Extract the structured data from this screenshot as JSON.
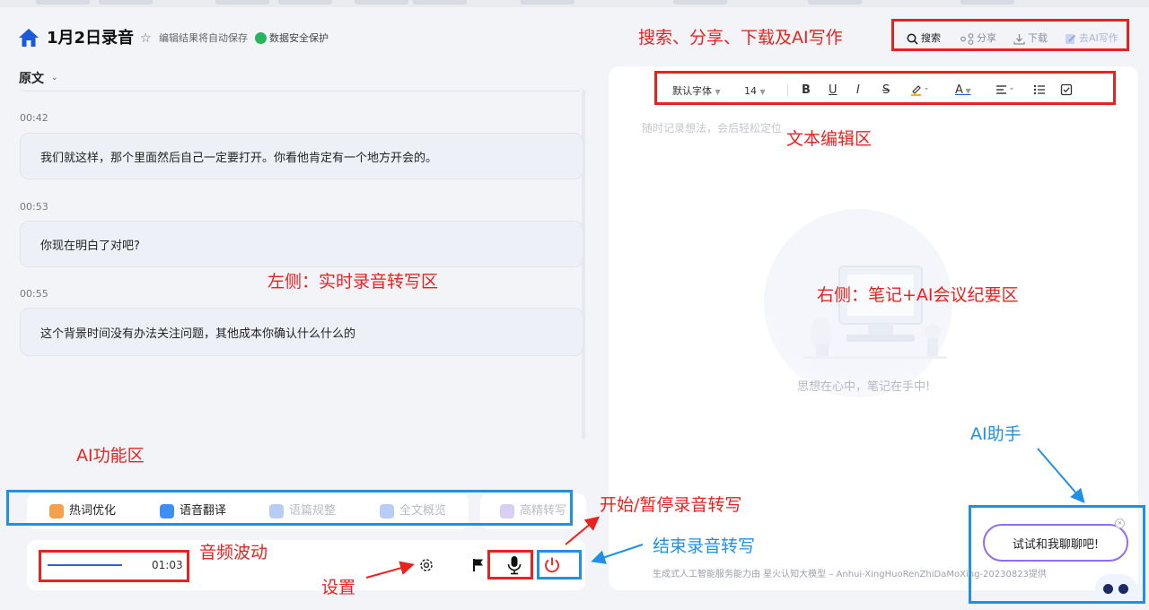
{
  "header": {
    "title": "1月2日录音",
    "autosave_note": "编辑结果将自动保存",
    "security_note": "数据安全保护",
    "actions": {
      "search": "搜索",
      "share": "分享",
      "download": "下载",
      "ai_write": "去AI写作"
    }
  },
  "transcript": {
    "section_label": "原文",
    "entries": [
      {
        "time": "00:42",
        "text": "我们就这样，那个里面然后自己一定要打开。你看他肯定有一个地方开会的。"
      },
      {
        "time": "00:53",
        "text": "你现在明白了对吧?"
      },
      {
        "time": "00:55",
        "text": "这个背景时间没有办法关注问题，其他成本你确认什么什么的"
      }
    ]
  },
  "ai_functions": [
    {
      "label": "热词优化",
      "color": "#f5a04a"
    },
    {
      "label": "语音翻译",
      "color": "#3d8ef5"
    },
    {
      "label": "语篇规整",
      "color": "#b8cdf5"
    },
    {
      "label": "全文概览",
      "color": "#b8cdf5"
    },
    {
      "label": "高精转写",
      "color": "#d9cff5"
    }
  ],
  "recorder": {
    "elapsed": "01:03"
  },
  "editor": {
    "font_family": "默认字体",
    "font_size": "14",
    "placeholder": "随时记录想法，会后轻松定位",
    "empty_state": "思想在心中，笔记在手中!",
    "footer": "生成式人工智能服务能力由 星火认知大模型 – Anhui-XingHuoRenZhiDaMoXing-20230823提供"
  },
  "assistant": {
    "greeting": "试试和我聊聊吧!"
  },
  "annotations": {
    "header_actions": "搜索、分享、下载及AI写作",
    "text_editor": "文本编辑区",
    "left_area": "左侧：实时录音转写区",
    "right_area": "右侧：笔记+AI会议纪要区",
    "ai_area": "AI功能区",
    "start_pause": "开始/暂停录音转写",
    "audio_wave": "音频波动",
    "end_recording": "结束录音转写",
    "settings": "设置",
    "ai_assistant": "AI助手"
  },
  "colors": {
    "annotation_red": "#e8231f",
    "annotation_blue": "#1e90e6",
    "brand_blue": "#1a5ad8",
    "security_green": "#2ab45e",
    "stop_red": "#f0302a"
  },
  "icons": [
    "home-icon",
    "star-icon",
    "shield-icon",
    "search-icon",
    "share-icon",
    "download-icon",
    "ai-write-icon",
    "chevron-down-icon",
    "gear-icon",
    "flag-icon",
    "microphone-icon",
    "power-icon",
    "robot-icon"
  ]
}
